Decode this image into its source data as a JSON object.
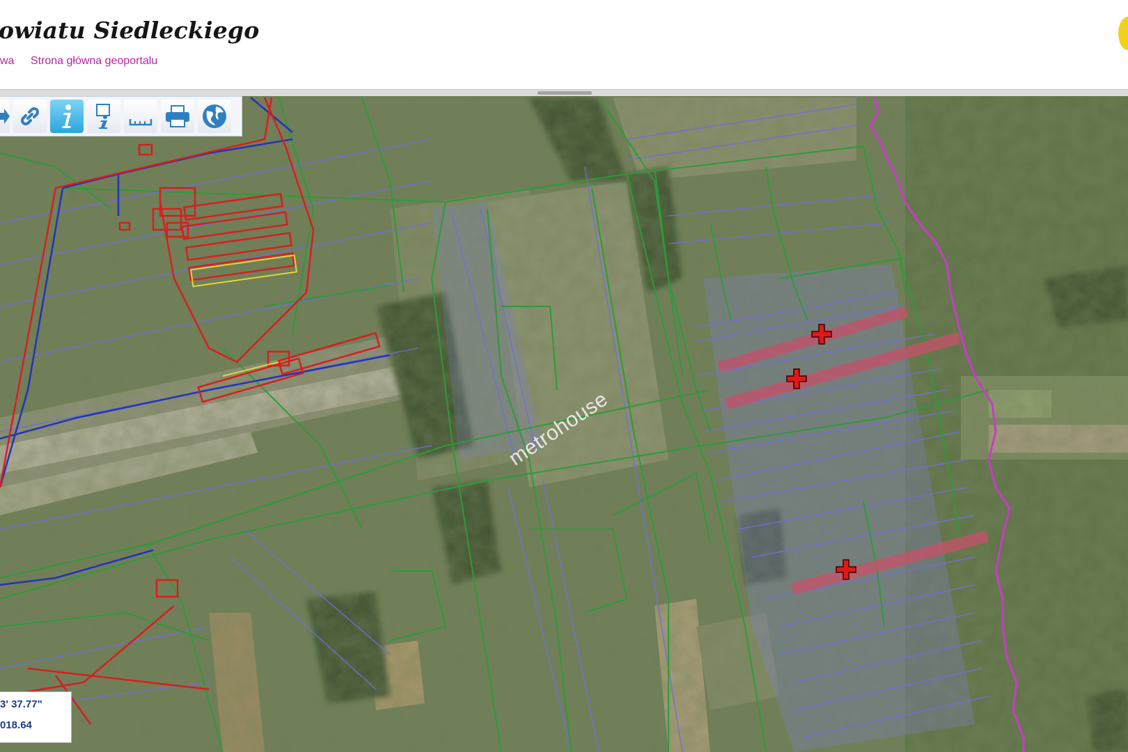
{
  "header": {
    "title": "owiatu Siedleckiego",
    "links": [
      "wa",
      "Strona główna geoportalu"
    ]
  },
  "toolbar": {
    "tools": [
      {
        "name": "pan-arrow-icon",
        "active": false
      },
      {
        "name": "link-icon",
        "active": false
      },
      {
        "name": "info-icon",
        "active": true
      },
      {
        "name": "info-document-icon",
        "active": false
      },
      {
        "name": "measure-ruler-icon",
        "active": false
      },
      {
        "name": "print-icon",
        "active": false
      },
      {
        "name": "globe-icon",
        "active": false
      }
    ]
  },
  "coordinates": {
    "line1": "3' 37.77\"",
    "line2": "018.64"
  },
  "watermark": "metrohouse",
  "markers": [
    "plot-marker",
    "plot-marker",
    "plot-marker"
  ],
  "colors": {
    "parcel_boundary": "#2f9a3a",
    "land_use_line": "#6f6fd8",
    "building_outline": "#d81e1e",
    "admin_boundary": "#c83cc8",
    "road_line": "#2233bb",
    "selected_plot": "#c8506a",
    "link_color": "#b325ab"
  }
}
